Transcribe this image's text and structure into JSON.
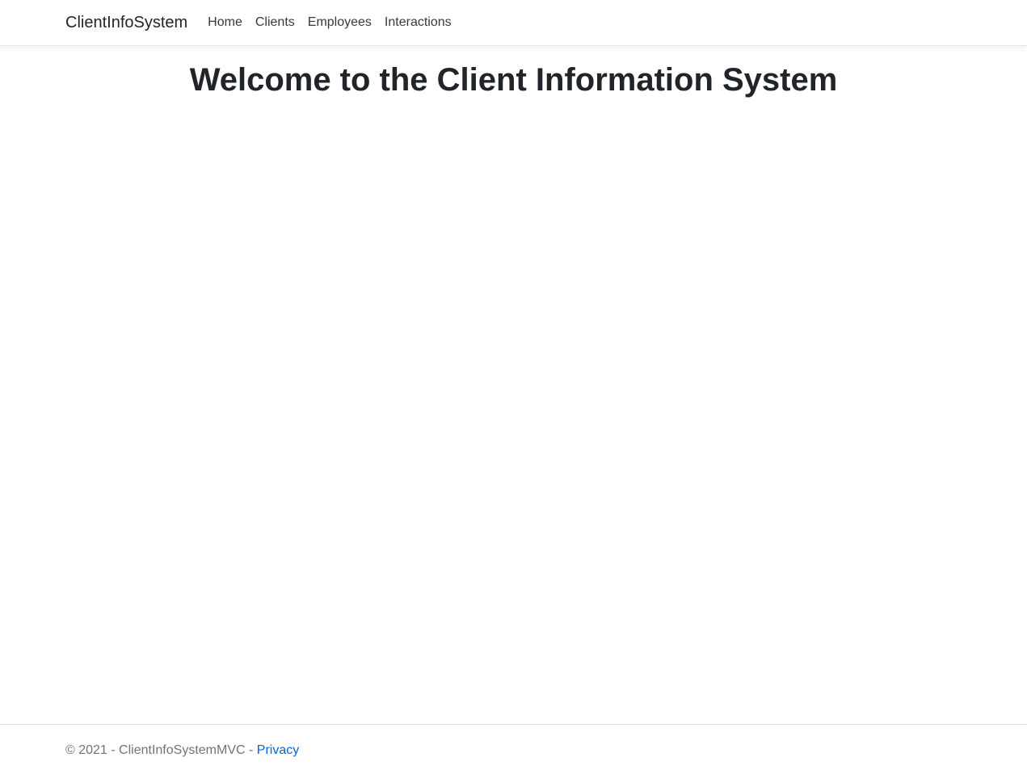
{
  "navbar": {
    "brand": "ClientInfoSystem",
    "links": [
      {
        "label": "Home"
      },
      {
        "label": "Clients"
      },
      {
        "label": "Employees"
      },
      {
        "label": "Interactions"
      }
    ]
  },
  "main": {
    "heading": "Welcome to the Client Information System"
  },
  "footer": {
    "copyright": "© 2021 - ClientInfoSystemMVC - ",
    "privacy_link": "Privacy"
  },
  "colors": {
    "link": "#0366d6",
    "text": "#212529",
    "muted": "#6c757d"
  }
}
